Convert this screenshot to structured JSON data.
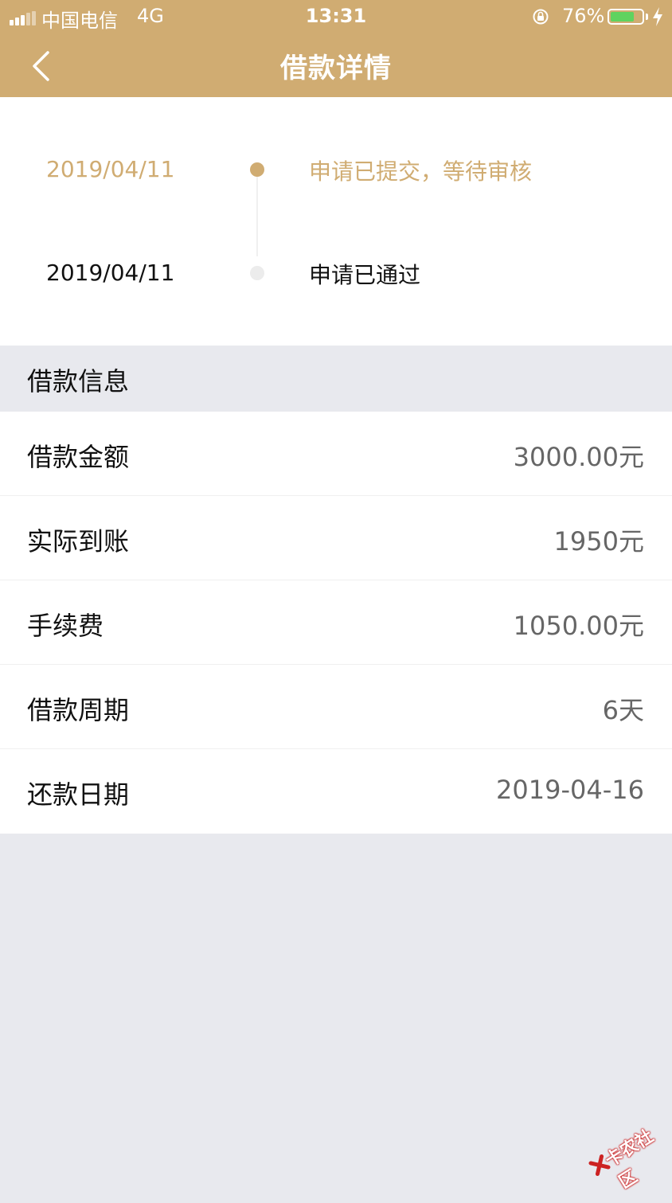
{
  "status_bar": {
    "carrier": "中国电信",
    "network": "4G",
    "time": "13:31",
    "battery_percent": "76%",
    "battery_level": 0.76,
    "charging": true
  },
  "nav": {
    "title": "借款详情",
    "back_icon": "chevron-left-icon"
  },
  "timeline": {
    "steps": [
      {
        "date": "2019/04/11",
        "text": "申请已提交，等待审核",
        "state": "active"
      },
      {
        "date": "2019/04/11",
        "text": "申请已通过",
        "state": "done"
      }
    ]
  },
  "loan_info": {
    "section_title": "借款信息",
    "rows": [
      {
        "label": "借款金额",
        "value": "3000.00元"
      },
      {
        "label": "实际到账",
        "value": "1950元"
      },
      {
        "label": "手续费",
        "value": "1050.00元"
      },
      {
        "label": "借款周期",
        "value": "6天"
      },
      {
        "label": "还款日期",
        "value": "2019-04-16"
      }
    ]
  },
  "watermark": {
    "text": "卡农社区"
  },
  "colors": {
    "brand_gold": "#d0ac72",
    "background": "#e8e9ee",
    "battery_green": "#5fd35f"
  }
}
